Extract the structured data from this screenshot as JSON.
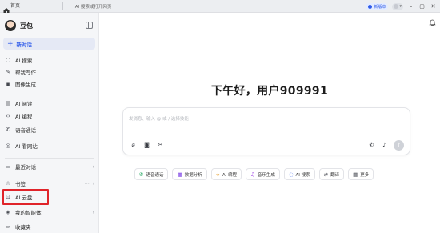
{
  "titlebar": {
    "home_label": "首页",
    "new_tab_label": "AI 搜索或打开网页",
    "badge_label": "新版本",
    "colors": {
      "accent": "#2f5bea"
    }
  },
  "sidebar": {
    "app_name": "豆包",
    "new_chat_label": "新对话",
    "items": [
      {
        "label": "AI 搜索",
        "icon": "ai-search-icon"
      },
      {
        "label": "帮我写作",
        "icon": "pen-icon"
      },
      {
        "label": "图像生成",
        "icon": "image-icon"
      },
      {
        "label": "AI 阅读",
        "icon": "book-icon"
      },
      {
        "label": "AI 编程",
        "icon": "code-icon"
      },
      {
        "label": "语音通话",
        "icon": "phone-icon"
      },
      {
        "label": "AI 看网站",
        "icon": "globe-icon"
      }
    ],
    "section_items": [
      {
        "label": "最近对话",
        "icon": "chat-icon"
      },
      {
        "label": "书签",
        "icon": "star-icon"
      },
      {
        "label": "AI 云盘",
        "icon": "cloud-drive-icon"
      },
      {
        "label": "我的智能体",
        "icon": "agent-icon"
      },
      {
        "label": "收藏夹",
        "icon": "folder-icon"
      }
    ]
  },
  "main": {
    "greeting": "下午好，用户909991",
    "input_placeholder": "发消息、输入 @ 或 / 选择技能",
    "chips": [
      {
        "label": "语音通话",
        "icon": "phone-icon",
        "color": "#1aa35a"
      },
      {
        "label": "数据分析",
        "icon": "chart-icon",
        "color": "#7b3fe4"
      },
      {
        "label": "AI 编程",
        "icon": "code-icon",
        "color": "#e08a00"
      },
      {
        "label": "音乐生成",
        "icon": "music-icon",
        "color": "#9b3fe4"
      },
      {
        "label": "AI 搜索",
        "icon": "search-icon",
        "color": "#2f5bea"
      },
      {
        "label": "翻译",
        "icon": "translate-icon",
        "color": "#4a4d55"
      },
      {
        "label": "更多",
        "icon": "grid-icon",
        "color": "#4a4d55"
      }
    ]
  }
}
